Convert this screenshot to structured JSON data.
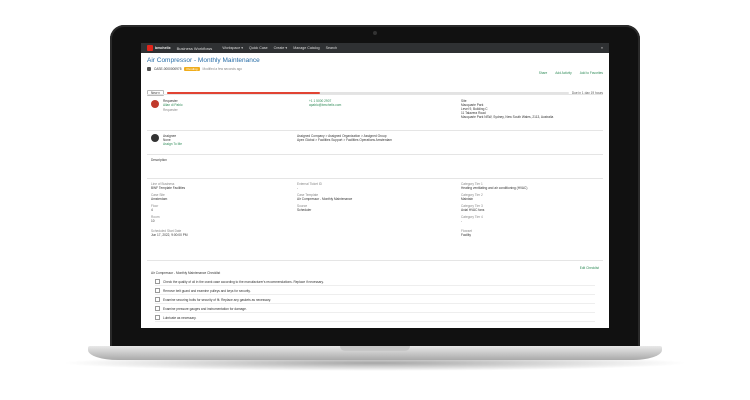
{
  "app": {
    "brand": "bmchelix",
    "title": "Business Workflows",
    "nav": [
      "Workspace",
      "Quick Case",
      "Create",
      "Manage Catalog",
      "Search"
    ]
  },
  "header": {
    "title": "Air Compressor - Monthly Maintenance",
    "id": "CASE-0000000975",
    "status": "Pending",
    "modified": "Modified a few seconds ago",
    "actions": [
      "Share",
      "Add Activity",
      "Add to Favorites"
    ]
  },
  "progress": {
    "view_label": "New",
    "fraction": 0.38,
    "due": "Due in 1 day 19 hours"
  },
  "requester": {
    "label": "Requester",
    "name": "Allan di Pablo",
    "role": "Requester",
    "phone": "+1 1 5000 2907",
    "email": "apablo@bmchelix.com",
    "site_label": "Site",
    "site_name": "Macquarie Park",
    "site_line2": "Level 9, Building C",
    "site_line3": "11 Talavera Road",
    "site_line4": "Macquarie Park NSW, Sydney, New South Wales, 2113, Australia"
  },
  "assignment": {
    "label": "Assignee",
    "value": "None",
    "assign_link": "Assign To Me",
    "group_label": "Assigned Company > Assigned Organization > Assigned Group",
    "group_value": "Apex Global > Facilities Support > Facilities Operations Amsterdam"
  },
  "description_label": "Description",
  "details": {
    "line_of_business_label": "Line of Business",
    "line_of_business": "BWF Template Facilities",
    "case_site_label": "Case Site",
    "case_site": "Amsterdam",
    "floor_label": "Floor",
    "floor": "4",
    "room_label": "Room",
    "room": "10",
    "scheduled_label": "Scheduled Start Date",
    "scheduled": "Jun 17, 2022, 9:00:00 PM",
    "external_ticket_label": "External Ticket ID",
    "external_ticket": "-",
    "case_template_label": "Case Template",
    "case_template": "Air Compressor - Monthly Maintenance",
    "source_label": "Source",
    "source": "Scheduler",
    "cat1_label": "Category Tier 1",
    "cat1": "Heating ventilating and air conditioning (HVAC)",
    "cat2_label": "Category Tier 2",
    "cat2": "Maintain",
    "cat3_label": "Category Tier 3",
    "cat3": "Axial HVAC fans",
    "cat4_label": "Category Tier 4",
    "cat4": "-",
    "flowset_label": "Flowset",
    "flowset": "Facility"
  },
  "checklist": {
    "title": "Air Compressor - Monthly Maintenance Checklist",
    "edit_link": "Edit Checklist",
    "items": [
      "Check the quality of oil in the crank case according to the manufacturer's recommendations. Replace if necessary.",
      "Remove belt guard and examine pulleys and keys for security.",
      "Examine securing bolts for security of fit. Replace any gaskets as necessary.",
      "Examine pressure gauges and instrumentation for damage.",
      "Lubricate as necessary."
    ]
  },
  "colors": {
    "accent": "#e14333",
    "link": "#2a6fa8",
    "topbar": "#2f3133",
    "status": "#f0ad1c"
  }
}
